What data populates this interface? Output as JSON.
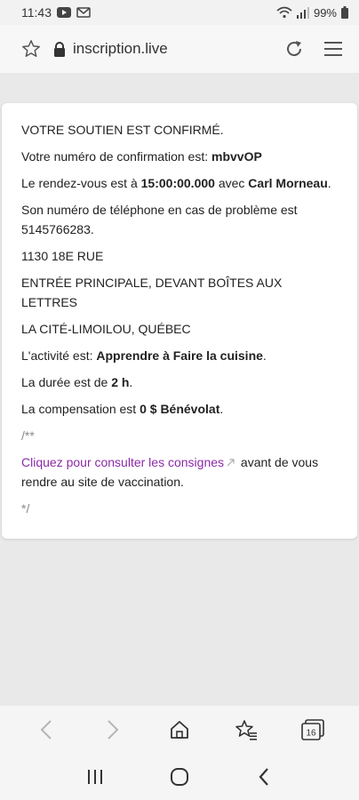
{
  "status_bar": {
    "time": "11:43",
    "battery": "99%",
    "icons": [
      "youtube-icon",
      "mail-icon",
      "wifi-icon",
      "signal-icon",
      "battery-icon"
    ]
  },
  "browser": {
    "url": "inscription.live"
  },
  "confirmation": {
    "heading": "VOTRE SOUTIEN EST CONFIRMÉ.",
    "number_label": "Votre numéro de confirmation est: ",
    "number_value": "mbvvOP",
    "appointment_prefix": "Le rendez-vous est à ",
    "appointment_time": "15:00:00.000",
    "appointment_middle": " avec ",
    "appointment_person": "Carl Morneau",
    "appointment_suffix": ".",
    "phone_text": "Son numéro de téléphone en cas de problème est 5145766283.",
    "address_line1": "1130 18E RUE",
    "address_line2": "ENTRÉE PRINCIPALE, DEVANT BOÎTES AUX LETTRES",
    "address_line3": "LA CITÉ-LIMOILOU, QUÉBEC",
    "activity_label": "L'activité est: ",
    "activity_value": "Apprendre à Faire la cuisine",
    "activity_suffix": ".",
    "duration_label": "La durée est de ",
    "duration_value": "2 h",
    "duration_suffix": ".",
    "compensation_label": "La compensation est ",
    "compensation_value": "0 $ Bénévolat",
    "compensation_suffix": ".",
    "comment_open": "/**",
    "link_text": "Cliquez pour consulter les consignes",
    "after_link_text": " avant de vous rendre au site de vaccination.",
    "comment_close": "*/"
  },
  "bottom_nav": {
    "tabs_count": "16",
    "icons": [
      "back-icon",
      "forward-icon",
      "home-icon",
      "bookmarks-icon",
      "tabs-icon"
    ]
  },
  "system_nav": {
    "icons": [
      "recents-icon",
      "home-circle-icon",
      "system-back-icon"
    ]
  },
  "colors": {
    "link": "#8d2aa8",
    "page_background": "#e9e9e9",
    "card_background": "#ffffff"
  }
}
